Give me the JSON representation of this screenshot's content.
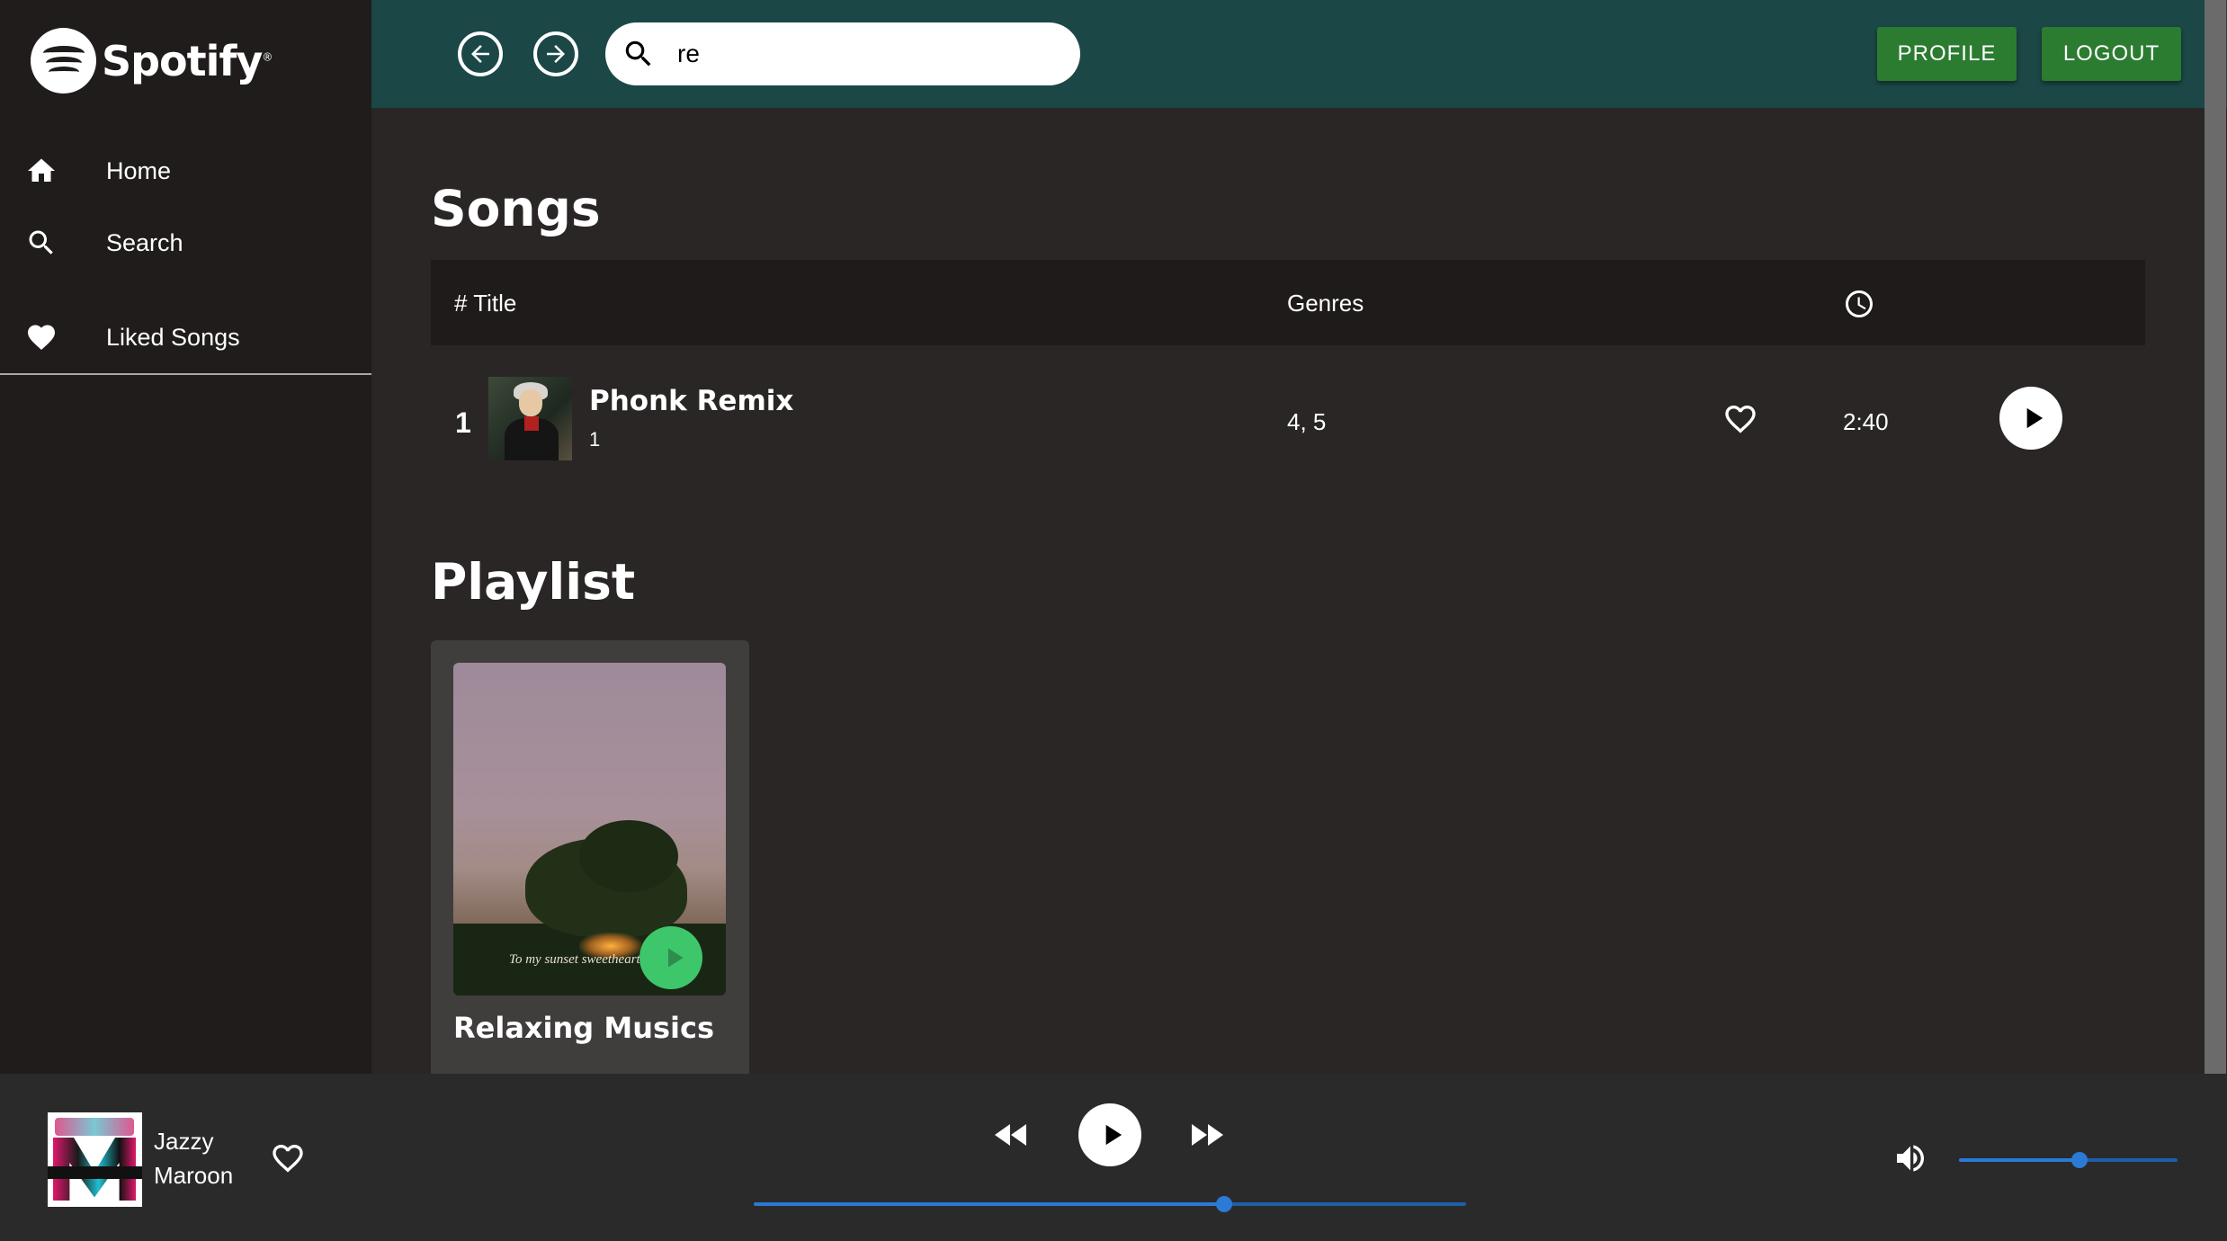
{
  "app": {
    "logo_text": "Spotify",
    "logo_mark": "®"
  },
  "sidebar": {
    "items": [
      {
        "label": "Home",
        "icon": "home-icon"
      },
      {
        "label": "Search",
        "icon": "search-icon"
      },
      {
        "label": "Liked Songs",
        "icon": "heart-icon"
      }
    ]
  },
  "header": {
    "search": {
      "value": "re",
      "placeholder": ""
    },
    "profile_label": "PROFILE",
    "logout_label": "LOGOUT",
    "colors": {
      "header_bg": "#1b4747",
      "button_bg": "#2b7c31"
    }
  },
  "songs": {
    "section_title": "Songs",
    "columns": {
      "title": "# Title",
      "genres": "Genres",
      "duration_icon": "clock-icon"
    },
    "rows": [
      {
        "number": "1",
        "title": "Phonk Remix",
        "subtitle": "1",
        "genres": "4, 5",
        "duration": "2:40",
        "liked": false
      }
    ]
  },
  "playlists": {
    "section_title": "Playlist",
    "items": [
      {
        "name": "Relaxing Musics",
        "cover_caption": "To my sunset sweetheart"
      }
    ]
  },
  "player": {
    "now_playing": {
      "title": "Jazzy",
      "artist": "Maroon",
      "liked": false
    },
    "progress": 0.66,
    "volume": 0.55,
    "accent_color": "#2a7ad6"
  }
}
